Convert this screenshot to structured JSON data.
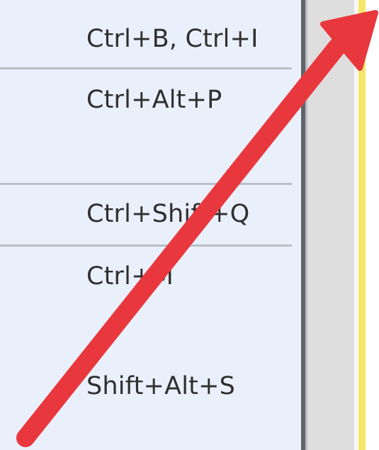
{
  "shortcuts": [
    {
      "keys": "Ctrl+B, Ctrl+I"
    },
    {
      "keys": "Ctrl+Alt+P"
    },
    {
      "keys": "Ctrl+Shift+Q"
    },
    {
      "keys": "Ctrl+M"
    },
    {
      "keys": "Shift+Alt+S"
    }
  ],
  "annotation": {
    "icon": "red-arrow-icon",
    "color": "#e8383d",
    "direction": "up-right"
  },
  "colors": {
    "menu_background": "#eaf0fb",
    "separator": "#b9bec6",
    "highlight_line": "#f3e86a"
  }
}
